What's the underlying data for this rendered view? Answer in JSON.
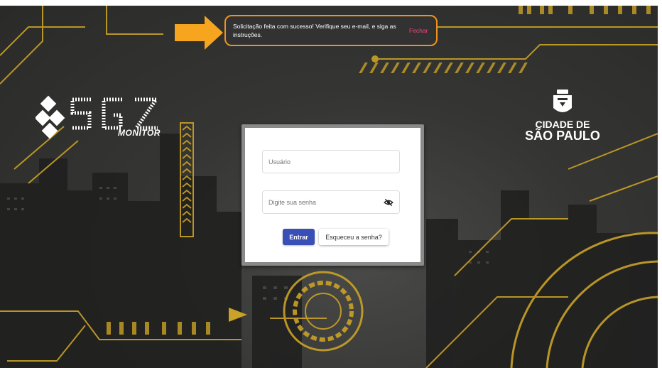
{
  "toast": {
    "message": "Solicitação feita com sucesso! Verifique seu e-mail, e siga as instruções.",
    "close_label": "Fechar"
  },
  "brand": {
    "product_name": "SGZ",
    "product_subtitle": "MONITOR",
    "city_line1": "CIDADE DE",
    "city_line2": "SÃO PAULO"
  },
  "login": {
    "username_placeholder": "Usuário",
    "password_placeholder": "Digite sua senha",
    "submit_label": "Entrar",
    "forgot_label": "Esqueceu a senha?"
  },
  "colors": {
    "primary_button": "#3a4fb5",
    "toast_border": "#f0921e",
    "toast_action": "#ff4081",
    "accent_gold": "#c9a227"
  }
}
